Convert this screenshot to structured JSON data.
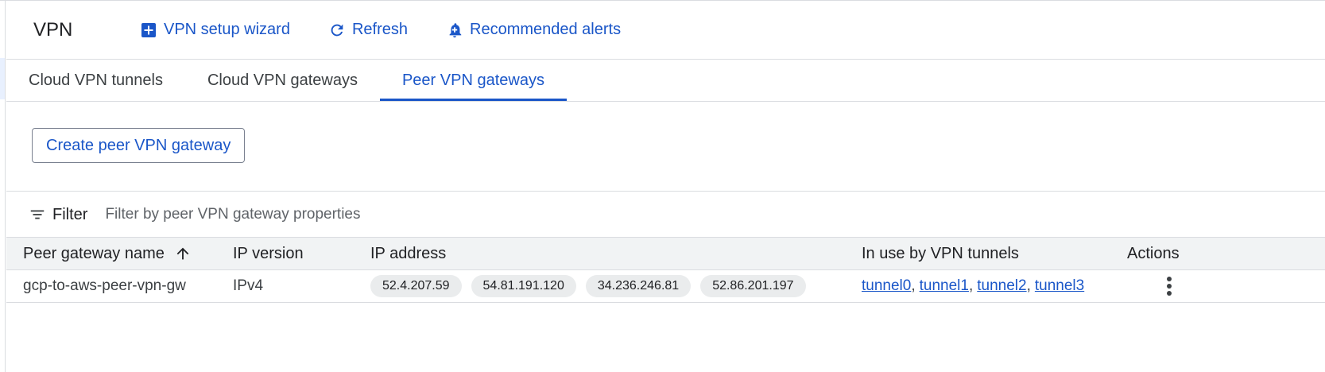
{
  "header": {
    "title": "VPN",
    "actions": [
      {
        "label": "VPN setup wizard",
        "icon": "add-box-icon"
      },
      {
        "label": "Refresh",
        "icon": "refresh-icon"
      },
      {
        "label": "Recommended alerts",
        "icon": "add-alert-bell-icon"
      }
    ]
  },
  "tabs": [
    {
      "label": "Cloud VPN tunnels",
      "active": false
    },
    {
      "label": "Cloud VPN gateways",
      "active": false
    },
    {
      "label": "Peer VPN gateways",
      "active": true
    }
  ],
  "create_button": {
    "label": "Create peer VPN gateway"
  },
  "filter": {
    "label": "Filter",
    "placeholder": "Filter by peer VPN gateway properties"
  },
  "table": {
    "columns": [
      "Peer gateway name",
      "IP version",
      "IP address",
      "In use by VPN tunnels",
      "Actions"
    ],
    "sort_column": "Peer gateway name",
    "sort_direction": "ascending",
    "rows": [
      {
        "name": "gcp-to-aws-peer-vpn-gw",
        "ip_version": "IPv4",
        "ip_addresses": [
          "52.4.207.59",
          "54.81.191.120",
          "34.236.246.81",
          "52.86.201.197"
        ],
        "tunnels": [
          "tunnel0",
          "tunnel1",
          "tunnel2",
          "tunnel3"
        ],
        "separator": ","
      }
    ]
  },
  "colors": {
    "accent": "#1a56c8",
    "divider": "#dadce0",
    "header_bg": "#f1f3f4",
    "chip_bg": "#eaeced"
  }
}
